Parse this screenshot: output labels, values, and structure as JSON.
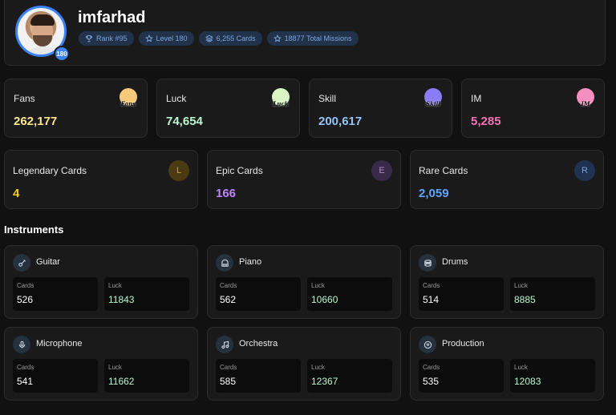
{
  "profile": {
    "username": "imfarhad",
    "level_badge": "180",
    "chips": [
      {
        "icon": "trophy-icon",
        "label": "Rank #95"
      },
      {
        "icon": "star-icon",
        "label": "Level 180"
      },
      {
        "icon": "layers-icon",
        "label": "6,255 Cards"
      },
      {
        "icon": "star-icon",
        "label": "18877 Total Missions"
      }
    ]
  },
  "stats": [
    {
      "label": "Fans",
      "value": "262,177",
      "coin_text": "Fans",
      "color": "#fde68a",
      "coin_color": "#f6c97a"
    },
    {
      "label": "Luck",
      "value": "74,654",
      "coin_text": "Luck",
      "color": "#bbf7d0",
      "coin_color": "#d9f5c4"
    },
    {
      "label": "Skill",
      "value": "200,617",
      "coin_text": "Skill",
      "color": "#93c5fd",
      "coin_color": "#8b7cf6"
    },
    {
      "label": "IM",
      "value": "5,285",
      "coin_text": "IM",
      "color": "#f472b6",
      "coin_color": "#f58fbf"
    }
  ],
  "rarities": [
    {
      "label": "Legendary Cards",
      "value": "4",
      "letter": "L",
      "color": "#facc15",
      "bg": "#4a3b12",
      "letter_color": "#c9a136"
    },
    {
      "label": "Epic Cards",
      "value": "166",
      "letter": "E",
      "color": "#c084fc",
      "bg": "#3a2a4a",
      "letter_color": "#a98bc4"
    },
    {
      "label": "Rare Cards",
      "value": "2,059",
      "letter": "R",
      "color": "#60a5fa",
      "bg": "#1f3350",
      "letter_color": "#7aa0cc"
    }
  ],
  "instruments_title": "Instruments",
  "instrument_labels": {
    "cards": "Cards",
    "luck": "Luck"
  },
  "instruments": [
    {
      "name": "Guitar",
      "icon": "guitar-icon",
      "cards": "526",
      "luck": "11843"
    },
    {
      "name": "Piano",
      "icon": "piano-icon",
      "cards": "562",
      "luck": "10660"
    },
    {
      "name": "Drums",
      "icon": "drums-icon",
      "cards": "514",
      "luck": "8885"
    },
    {
      "name": "Microphone",
      "icon": "microphone-icon",
      "cards": "541",
      "luck": "11662"
    },
    {
      "name": "Orchestra",
      "icon": "music-note-icon",
      "cards": "585",
      "luck": "12367"
    },
    {
      "name": "Production",
      "icon": "disc-icon",
      "cards": "535",
      "luck": "12083"
    }
  ],
  "colors": {
    "accent": "#3b82f6",
    "luck_value": "#bbf7d0",
    "background": "#111111",
    "panel": "#1a1a1a"
  }
}
